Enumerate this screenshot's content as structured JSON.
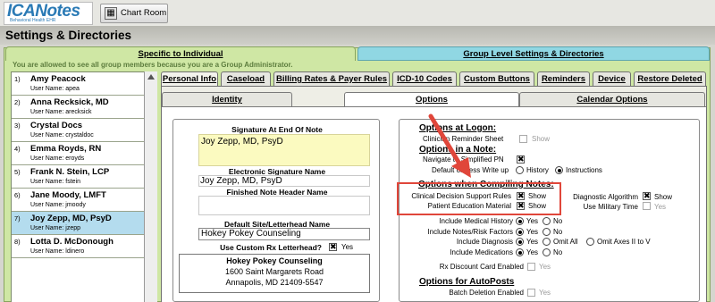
{
  "app": {
    "logo_text": "ICANotes",
    "logo_sub": "Behavioral Health EHR",
    "chart_room_label": "Chart Room"
  },
  "page_title": "Settings & Directories",
  "top_tabs": {
    "individual": "Specific to Individual",
    "group": "Group Level Settings & Directories"
  },
  "admin_note": "You are allowed to see all group members because you are a Group Administrator.",
  "users": [
    {
      "num": "1)",
      "name": "Amy Peacock",
      "username": "User Name: apea"
    },
    {
      "num": "2)",
      "name": "Anna Recksick, MD",
      "username": "User Name: arecksick"
    },
    {
      "num": "3)",
      "name": "Crystal Docs",
      "username": "User Name: crystaldoc"
    },
    {
      "num": "4)",
      "name": "Emma Royds, RN",
      "username": "User Name: eroyds"
    },
    {
      "num": "5)",
      "name": "Frank N. Stein, LCP",
      "username": "User Name: fstein"
    },
    {
      "num": "6)",
      "name": "Jane Moody, LMFT",
      "username": "User Name: jmoody"
    },
    {
      "num": "7)",
      "name": "Joy Zepp, MD, PsyD",
      "username": "User Name: jzepp"
    },
    {
      "num": "8)",
      "name": "Lotta D. McDonough",
      "username": "User Name: ldinero"
    }
  ],
  "person_tabs": [
    "Personal Info",
    "Caseload",
    "Billing Rates & Payer Rules",
    "ICD-10 Codes",
    "Custom Buttons",
    "Reminders",
    "Device",
    "Restore Deleted"
  ],
  "sub_tabs": [
    "Identity",
    "Options",
    "Calendar Options"
  ],
  "left": {
    "sig_label": "Signature At End Of Note",
    "sig_value": "Joy Zepp, MD, PsyD",
    "esig_label": "Electronic Signature Name",
    "esig_value": "Joy Zepp, MD, PsyD",
    "header_label": "Finished Note Header Name",
    "header_value": "",
    "site_label": "Default Site/Letterhead Name",
    "site_value": "Hokey Pokey Counseling",
    "rx_label": "Use Custom Rx Letterhead?",
    "rx_yes": "Yes",
    "letterhead_name": "Hokey Pokey Counseling",
    "letterhead_addr1": "1600 Saint Margarets Road",
    "letterhead_addr2": "Annapolis, MD 21409-5547"
  },
  "right": {
    "logon_head": "Options at Logon:",
    "clinician_reminder": "Clinician Reminder Sheet",
    "show": "Show",
    "innote_head": "Options in a Note:",
    "navigate": "Navigate to Simplified PN",
    "history_label": "Default of Sess Write up",
    "history_opt": "History",
    "instructions_opt": "Instructions",
    "compile_head": "Options when Compiling Notes:",
    "cds": "Clinical Decision Support Rules",
    "pem": "Patient Education Material",
    "diag_algo": "Diagnostic Algorithm",
    "military": "Use Military Time",
    "yes": "Yes",
    "no": "No",
    "incl_med_hist": "Include Medical History",
    "incl_notes_risk": "Include Notes/Risk Factors",
    "incl_diag": "Include Diagnosis",
    "omit_all": "Omit All",
    "omit_axes": "Omit Axes II to V",
    "incl_meds": "Include Medications",
    "rx_discount": "Rx Discount Card Enabled",
    "autopost_head": "Options for AutoPosts",
    "batch_delete": "Batch Deletion Enabled"
  },
  "colors": {
    "highlight": "#e0463a",
    "selected_row": "#b4dcee",
    "green_panel": "#cfe7a4",
    "blue_tab": "#90d7e3",
    "sig_field": "#fbfac0"
  }
}
